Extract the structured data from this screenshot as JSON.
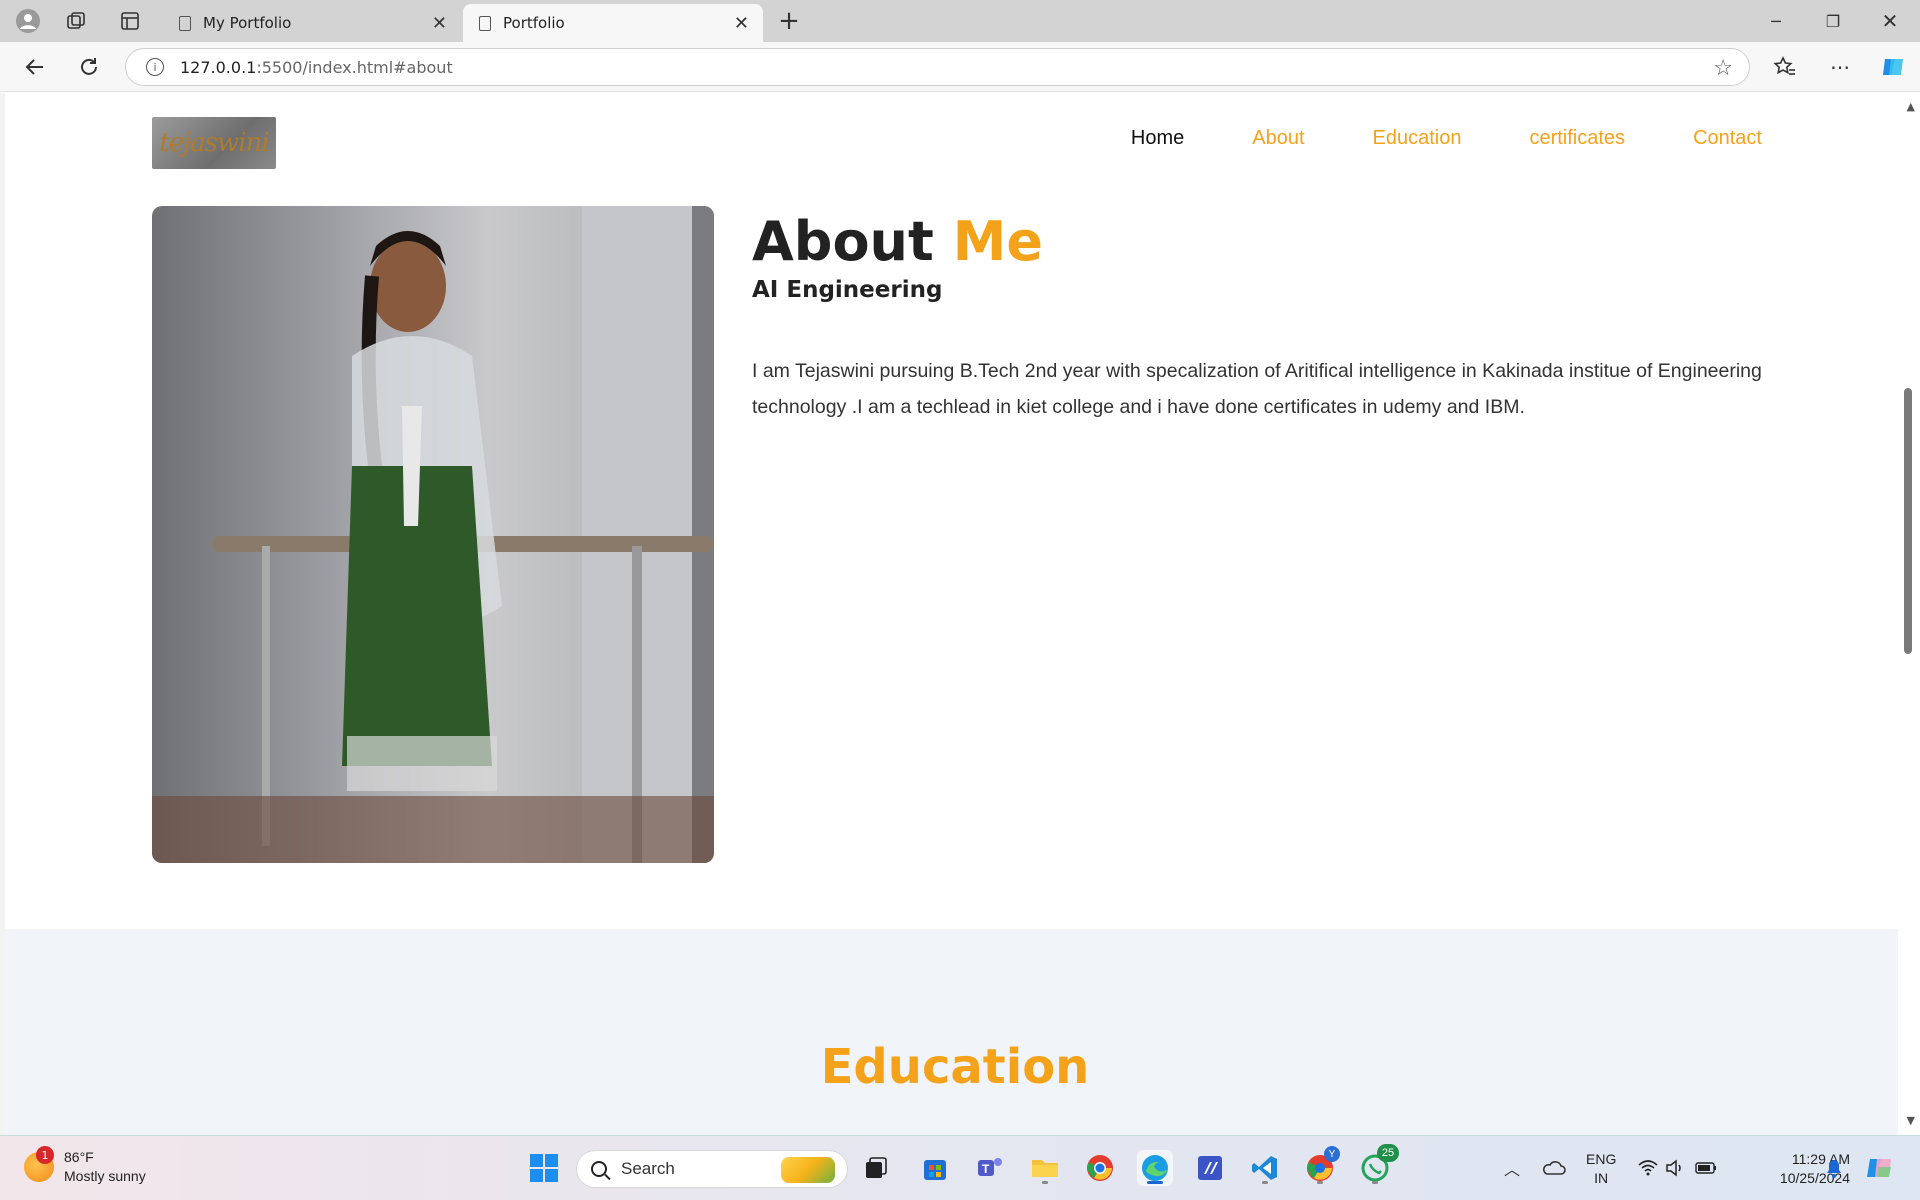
{
  "browser": {
    "tabs": [
      {
        "title": "My Portfolio",
        "active": false
      },
      {
        "title": "Portfolio",
        "active": true
      }
    ],
    "url_host": "127.0.0.1",
    "url_path": ":5500/index.html#about"
  },
  "site": {
    "logo_text": "tejaswini",
    "nav": [
      "Home",
      "About",
      "Education",
      "certificates",
      "Contact"
    ],
    "about": {
      "title_main": "About",
      "title_accent": "Me",
      "subtitle": "AI Engineering",
      "description": "I am Tejaswini pursuing B.Tech 2nd year with specalization of Aritifical intelligence in Kakinada institue of Engineering technology .I am a techlead in kiet college and i have done certificates in udemy and IBM."
    },
    "education_title": "Education"
  },
  "colors": {
    "accent": "#f5a21b",
    "text": "#222222",
    "section_bg": "#f1f4f8"
  },
  "taskbar": {
    "weather_temp": "86°F",
    "weather_desc": "Mostly sunny",
    "weather_badge": "1",
    "search_placeholder": "Search",
    "whatsapp_badge": "25",
    "chrome_badge": "Y",
    "lang_1": "ENG",
    "lang_2": "IN",
    "time": "11:29 AM",
    "date": "10/25/2024"
  }
}
